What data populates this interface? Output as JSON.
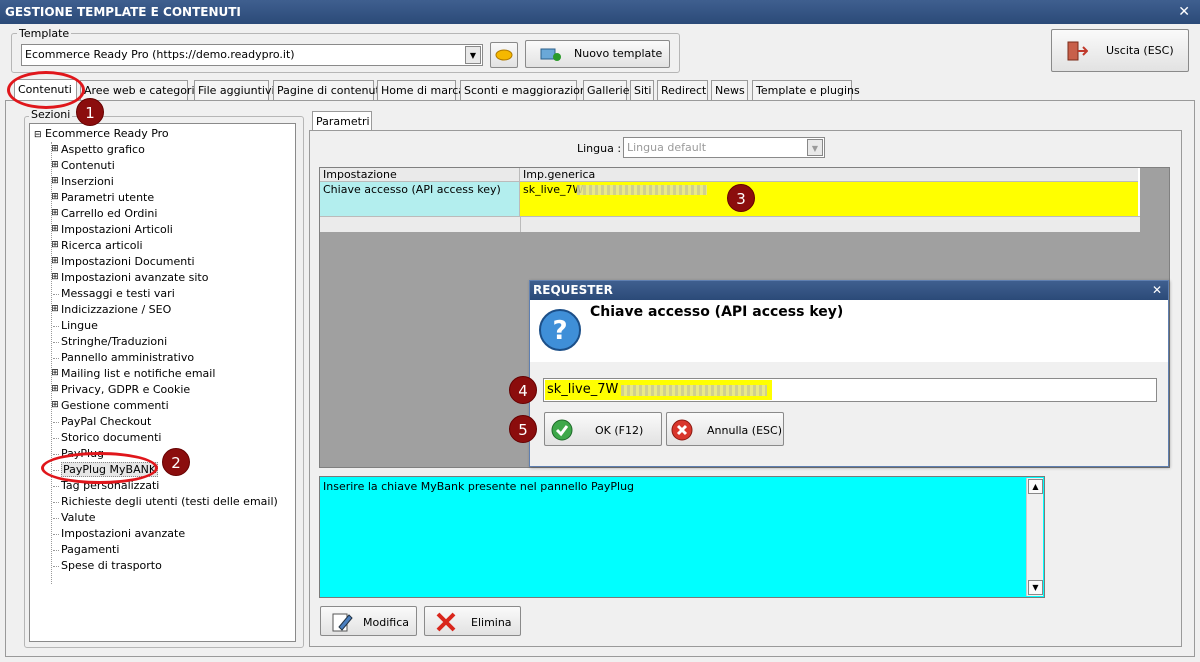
{
  "window": {
    "title": "GESTIONE TEMPLATE E CONTENUTI",
    "close_glyph": "✕"
  },
  "template": {
    "label": "Template",
    "selected": "Ecommerce Ready Pro (https://demo.readypro.it)",
    "new_button": "Nuovo template"
  },
  "exit_button": "Uscita (ESC)",
  "tabs": [
    "Contenuti",
    "Aree web e categorie",
    "File aggiuntivi",
    "Pagine di contenuti",
    "Home di marca",
    "Sconti e maggiorazioni",
    "Gallerie",
    "Siti",
    "Redirect",
    "News",
    "Template e plugins"
  ],
  "sections": {
    "label": "Sezioni",
    "root": "Ecommerce Ready Pro",
    "items": [
      {
        "label": "Aspetto grafico",
        "expandable": true
      },
      {
        "label": "Contenuti",
        "expandable": true
      },
      {
        "label": "Inserzioni",
        "expandable": true
      },
      {
        "label": "Parametri utente",
        "expandable": true
      },
      {
        "label": "Carrello ed Ordini",
        "expandable": true
      },
      {
        "label": "Impostazioni Articoli",
        "expandable": true
      },
      {
        "label": "Ricerca articoli",
        "expandable": true
      },
      {
        "label": "Impostazioni Documenti",
        "expandable": true
      },
      {
        "label": "Impostazioni avanzate sito",
        "expandable": true
      },
      {
        "label": "Messaggi e testi vari",
        "expandable": false
      },
      {
        "label": "Indicizzazione / SEO",
        "expandable": true
      },
      {
        "label": "Lingue",
        "expandable": false
      },
      {
        "label": "Stringhe/Traduzioni",
        "expandable": false
      },
      {
        "label": "Pannello amministrativo",
        "expandable": false
      },
      {
        "label": "Mailing list e notifiche email",
        "expandable": true
      },
      {
        "label": "Privacy, GDPR e Cookie",
        "expandable": true
      },
      {
        "label": "Gestione commenti",
        "expandable": true
      },
      {
        "label": "PayPal Checkout",
        "expandable": false
      },
      {
        "label": "Storico documenti",
        "expandable": false
      },
      {
        "label": "PayPlug",
        "expandable": false
      },
      {
        "label": "PayPlug MyBANK",
        "expandable": false
      },
      {
        "label": "Tag personalizzati",
        "expandable": false
      },
      {
        "label": "Richieste degli utenti (testi delle email)",
        "expandable": false
      },
      {
        "label": "Valute",
        "expandable": false
      },
      {
        "label": "Impostazioni avanzate",
        "expandable": false
      },
      {
        "label": "Pagamenti",
        "expandable": false
      },
      {
        "label": "Spese di trasporto",
        "expandable": false
      }
    ]
  },
  "params": {
    "tab": "Parametri",
    "lingua_label": "Lingua :",
    "lingua_value": "Lingua default",
    "grid": {
      "headers": [
        "Impostazione",
        "Imp.generica"
      ],
      "row_setting": "Chiave accesso (API access key)",
      "row_value": "sk_live_7W"
    },
    "description": "Inserire la chiave MyBank presente nel pannello PayPlug",
    "edit_button": "Modifica",
    "delete_button": "Elimina"
  },
  "requester": {
    "title": "REQUESTER",
    "heading": "Chiave accesso (API access key)",
    "input_value": "sk_live_7W",
    "ok_button": "OK (F12)",
    "cancel_button": "Annulla (ESC)"
  },
  "badges": [
    "1",
    "2",
    "3",
    "4",
    "5"
  ],
  "colors": {
    "highlight_yellow": "#ffff00",
    "cyan": "#00ffff",
    "selected_cell": "#b3eeee",
    "annotation_red": "#e0161b",
    "badge": "#8b0d0d"
  }
}
